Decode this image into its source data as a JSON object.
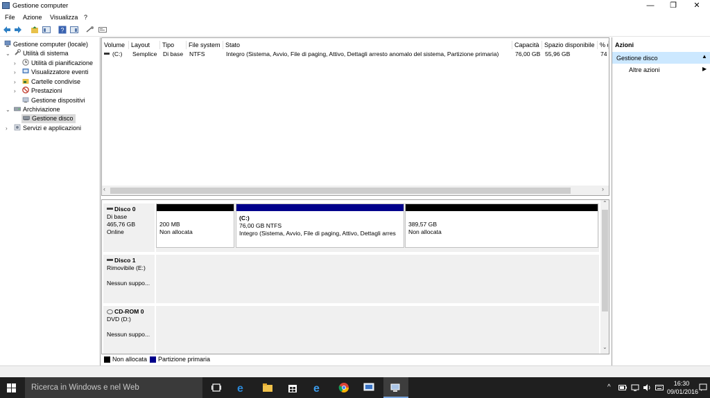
{
  "window": {
    "title": "Gestione computer",
    "minimize_glyph": "—",
    "restore_glyph": "❐",
    "close_glyph": "✕"
  },
  "menu": [
    "File",
    "Azione",
    "Visualizza",
    "?"
  ],
  "toolbar": {
    "icons": [
      "back-arrow-icon",
      "forward-arrow-icon",
      "folder-up-icon",
      "console-tree-icon",
      "help-icon",
      "properties-icon",
      "connect-icon",
      "view-icon"
    ]
  },
  "tree": {
    "root": "Gestione computer (locale)",
    "system_tools": "Utilità di sistema",
    "task_scheduler": "Utilità di pianificazione",
    "event_viewer": "Visualizzatore eventi",
    "shared_folders": "Cartelle condivise",
    "performance": "Prestazioni",
    "device_manager": "Gestione dispositivi",
    "storage": "Archiviazione",
    "disk_management": "Gestione disco",
    "services": "Servizi e applicazioni"
  },
  "volume_list": {
    "headers": [
      "Volume",
      "Layout",
      "Tipo",
      "File system",
      "Stato",
      "Capacità",
      "Spazio disponibile",
      "% d"
    ],
    "rows": [
      [
        "(C:)",
        "Semplice",
        "Di base",
        "NTFS",
        "Integro (Sistema, Avvio, File di paging, Attivo, Dettagli arresto anomalo del sistema, Partizione primaria)",
        "76,00 GB",
        "55,96 GB",
        "74"
      ]
    ]
  },
  "disks": [
    {
      "name": "Disco 0",
      "type": "Di base",
      "size": "465,76 GB",
      "status": "Online",
      "partitions": [
        {
          "line1": "",
          "line2": "200 MB",
          "line3": "Non allocata"
        },
        {
          "line1": "(C:)",
          "line2": "76,00 GB NTFS",
          "line3": "Integro (Sistema, Avvio, File di paging, Attivo, Dettagli arres"
        },
        {
          "line1": "",
          "line2": "389,57 GB",
          "line3": "Non allocata"
        }
      ]
    },
    {
      "name": "Disco 1",
      "type": "Rimovibile (E:)",
      "size": "",
      "status": "Nessun suppo..."
    },
    {
      "name": "CD-ROM 0",
      "type": "DVD (D:)",
      "size": "",
      "status": "Nessun suppo..."
    }
  ],
  "legend": {
    "unallocated": "Non allocata",
    "primary": "Partizione primaria"
  },
  "colors": {
    "unallocated": "#000000",
    "primary": "#00008b",
    "selection": "#cce8ff"
  },
  "actions": {
    "header": "Azioni",
    "section": "Gestione disco",
    "more": "Altre azioni"
  },
  "taskbar": {
    "search_placeholder": "Ricerca in Windows e nel Web",
    "time": "16:30",
    "date": "09/01/2016"
  }
}
